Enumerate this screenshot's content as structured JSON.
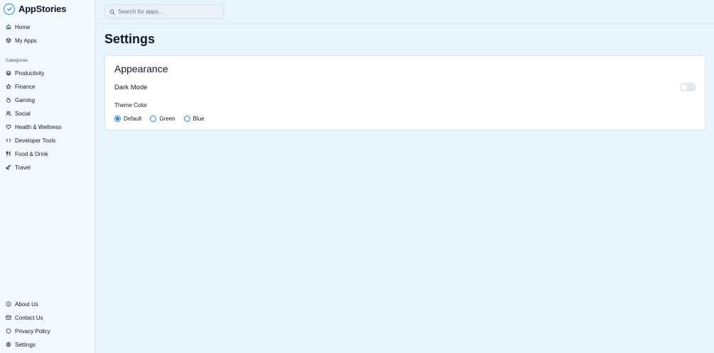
{
  "app": {
    "name": "AppStories"
  },
  "search": {
    "placeholder": "Search for apps..."
  },
  "sidebar": {
    "top_items": [
      {
        "label": "Home",
        "icon": "home-icon"
      },
      {
        "label": "My Apps",
        "icon": "package-icon"
      }
    ],
    "categories_label": "Categories",
    "categories": [
      {
        "label": "Productivity",
        "icon": "layers-icon"
      },
      {
        "label": "Finance",
        "icon": "star-icon"
      },
      {
        "label": "Gaming",
        "icon": "flame-icon"
      },
      {
        "label": "Social",
        "icon": "users-icon"
      },
      {
        "label": "Health & Wellness",
        "icon": "heart-icon"
      },
      {
        "label": "Developer Tools",
        "icon": "code-icon"
      },
      {
        "label": "Food & Drink",
        "icon": "utensils-icon"
      },
      {
        "label": "Travel",
        "icon": "plane-icon"
      }
    ],
    "bottom_items": [
      {
        "label": "About Us",
        "icon": "info-icon"
      },
      {
        "label": "Contact Us",
        "icon": "mail-icon"
      },
      {
        "label": "Privacy Policy",
        "icon": "shield-icon"
      },
      {
        "label": "Settings",
        "icon": "gear-icon"
      }
    ]
  },
  "page": {
    "title": "Settings"
  },
  "appearance": {
    "title": "Appearance",
    "dark_mode_label": "Dark Mode",
    "dark_mode_on": false,
    "theme_color_label": "Theme Color",
    "theme_options": [
      "Default",
      "Green",
      "Blue"
    ],
    "selected_theme": "Default"
  },
  "colors": {
    "accent": "#2b82c9",
    "background": "#e6f4fc",
    "sidebar": "#f3f9fd",
    "card": "#ffffff"
  }
}
